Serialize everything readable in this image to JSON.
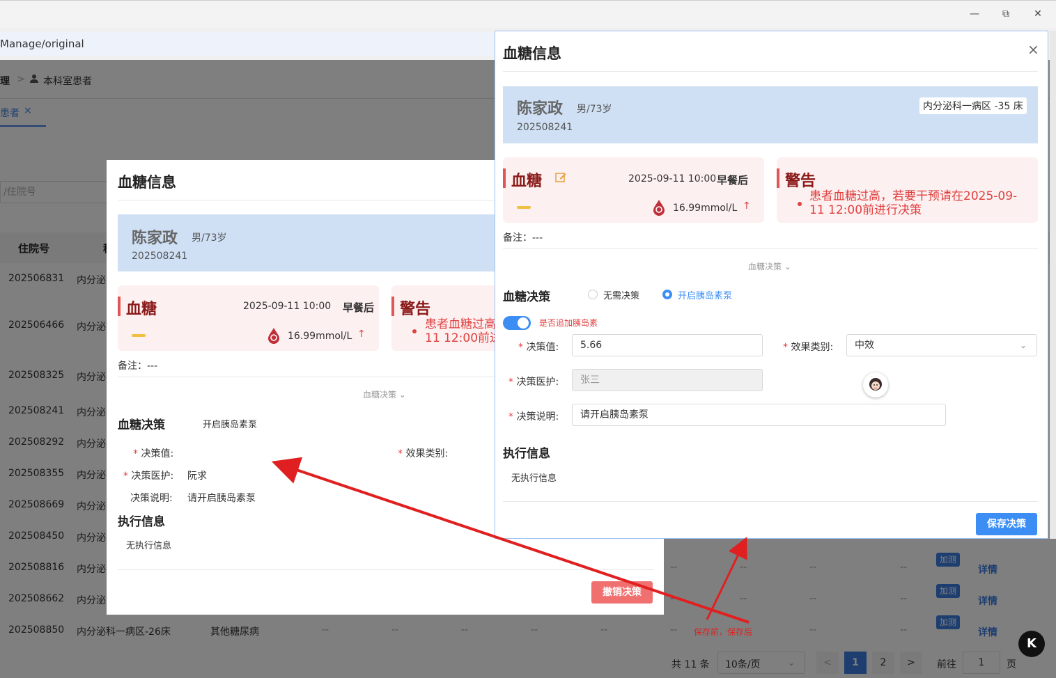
{
  "browser": {
    "address": "Manage/original",
    "minimize": "—",
    "restore": "⧉",
    "close": "✕"
  },
  "app": {
    "breadcrumb_prefix": "理",
    "breadcrumb_sep": ">",
    "breadcrumb_current": "本科室患者",
    "tab_label": "患者",
    "tab_close": "×",
    "search_placeholder": "/住院号",
    "table": {
      "col_inpatient": "住院号",
      "col_second": "科",
      "rows": [
        {
          "id": "202506831",
          "dept": "内分泌"
        },
        {
          "id": "202506466",
          "dept": "内分泌"
        },
        {
          "id": "202508325",
          "dept": "内分泌"
        },
        {
          "id": "202508241",
          "dept": "内分泌"
        },
        {
          "id": "202508292",
          "dept": "内分泌"
        },
        {
          "id": "202508355",
          "dept": "内分泌"
        },
        {
          "id": "202508669",
          "dept": "内分泌"
        },
        {
          "id": "202508450",
          "dept": "内分泌"
        },
        {
          "id": "202508816",
          "dept": "内分泌"
        },
        {
          "id": "202508662",
          "dept": "内分泌"
        },
        {
          "id": "202508850",
          "dept": "内分泌科一病区-26床",
          "disease": "其他糖尿病"
        }
      ],
      "dash": "--",
      "add_test": "加测",
      "details": "详情"
    },
    "pagination": {
      "total": "共 11 条",
      "page_size": "10条/页",
      "prev": "<",
      "page1": "1",
      "page2": "2",
      "next": ">",
      "goto": "前往",
      "goto_value": "1",
      "page_unit": "页"
    }
  },
  "dialog_after": {
    "title": "血糖信息",
    "patient_name": "陈家政",
    "patient_gender_age": "男/73岁",
    "patient_id": "202508241",
    "glucose_title": "血糖",
    "glucose_time": "2025-09-11 10:00",
    "glucose_period": "早餐后",
    "glucose_value": "16.99mmol/L",
    "glucose_trend": "↑",
    "warning_title": "警告",
    "warning_line1": "患者血糖过高",
    "warning_line2": "11 12:00前进",
    "remark": "备注：---",
    "decision_toggle": "血糖决策",
    "decision_section": "血糖决策",
    "decision_value": "开启胰岛素泵",
    "label_decision_value": "决策值:",
    "label_effect": "效果类别:",
    "label_doctor": "决策医护:",
    "doctor_value": "阮求",
    "label_note": "决策说明:",
    "note_value": "请开启胰岛素泵",
    "exec_section": "执行信息",
    "exec_empty": "无执行信息",
    "cancel_button": "撤销决策"
  },
  "dialog_before": {
    "title": "血糖信息",
    "close": "×",
    "patient_name": "陈家政",
    "patient_gender_age": "男/73岁",
    "patient_id": "202508241",
    "ward_bed": "内分泌科一病区 -35 床",
    "glucose_title": "血糖",
    "glucose_time": "2025-09-11 10:00",
    "glucose_period": "早餐后",
    "glucose_value": "16.99mmol/L",
    "glucose_trend": "↑",
    "warning_title": "警告",
    "warning_line1": "患者血糖过高，若要干预请在2025-09-",
    "warning_line2": "11 12:00前进行决策",
    "remark": "备注：---",
    "decision_toggle": "血糖决策",
    "decision_section": "血糖决策",
    "radio_none": "无需决策",
    "radio_pump": "开启胰岛素泵",
    "switch_label": "是否追加胰岛素",
    "label_decision_value": "决策值:",
    "decision_value": "5.66",
    "label_effect": "效果类别:",
    "effect_value": "中效",
    "label_doctor": "决策医护:",
    "doctor_value": "张三",
    "label_note": "决策说明:",
    "note_value": "请开启胰岛素泵",
    "exec_section": "执行信息",
    "exec_empty": "无执行信息",
    "save_button": "保存决策"
  },
  "annotation": {
    "label": "保存前，保存后",
    "color": "#e02020"
  },
  "colors": {
    "accent": "#3c8ef5",
    "danger": "#e04040",
    "patient_card": "#cfe0f5",
    "glucose_card": "#fdf0f0"
  }
}
